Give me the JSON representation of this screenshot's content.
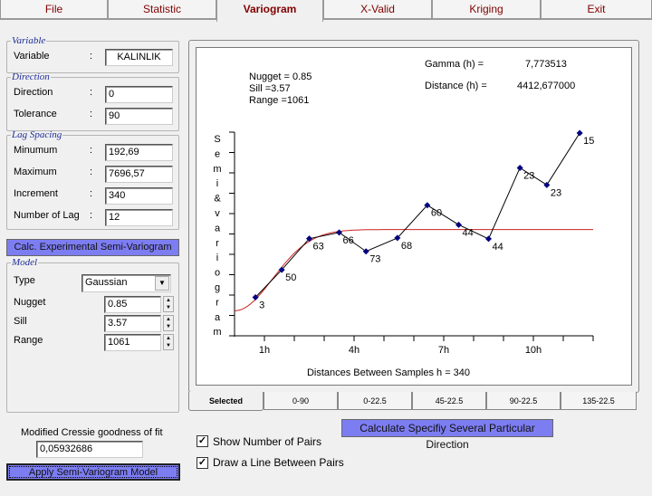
{
  "menu_tabs": [
    {
      "label": "File"
    },
    {
      "label": "Statistic"
    },
    {
      "label": "Variogram",
      "active": true
    },
    {
      "label": "X-Valid"
    },
    {
      "label": "Kriging"
    },
    {
      "label": "Exit"
    }
  ],
  "variable": {
    "legend": "Variable",
    "label": "Variable",
    "sep": ":",
    "value": "KALINLIK"
  },
  "direction": {
    "legend": "Direction",
    "direction_label": "Direction",
    "direction_value": "0",
    "tolerance_label": "Tolerance",
    "tolerance_value": "90"
  },
  "lag": {
    "legend": "Lag Spacing",
    "min_label": "Minumum",
    "min_value": "192,69",
    "max_label": "Maximum",
    "max_value": "7696,57",
    "inc_label": "Increment",
    "inc_value": "340",
    "num_label": "Number of Lag",
    "num_value": "12"
  },
  "calc_button": "Calc. Experimental Semi-Variogram",
  "model": {
    "legend": "Model",
    "type_label": "Type",
    "type_value": "Gaussian",
    "nugget_label": "Nugget",
    "nugget_value": "0.85",
    "sill_label": "Sill",
    "sill_value": "3.57",
    "range_label": "Range",
    "range_value": "1061"
  },
  "fit": {
    "label": "Modified Cressie goodness of fit",
    "value": "0,05932686"
  },
  "apply_button": "Apply Semi-Variogram Model",
  "chart_info": {
    "nugget": "Nugget = 0.85",
    "sill": "Sill =3.57",
    "range": "Range =1061",
    "gamma_label": "Gamma (h)  =",
    "gamma_value": "7,773513",
    "distance_label": "Distance (h) =",
    "distance_value": "4412,677000"
  },
  "chart_data": {
    "type": "scatter",
    "ylabel": "Semi&variogram",
    "xlabel": "Distances Between Samples h = 340",
    "xticks": [
      {
        "at": 1,
        "label": "1h"
      },
      {
        "at": 4,
        "label": "4h"
      },
      {
        "at": 7,
        "label": "7h"
      },
      {
        "at": 10,
        "label": "10h"
      }
    ],
    "xlim": [
      0,
      12
    ],
    "ylim": [
      -0.25,
      8.7
    ],
    "points": [
      {
        "x": 0.7,
        "y": 1.44,
        "pairs": "3"
      },
      {
        "x": 1.58,
        "y": 2.65,
        "pairs": "50"
      },
      {
        "x": 2.5,
        "y": 4.02,
        "pairs": "63"
      },
      {
        "x": 3.5,
        "y": 4.29,
        "pairs": "66"
      },
      {
        "x": 4.4,
        "y": 3.46,
        "pairs": "73"
      },
      {
        "x": 5.45,
        "y": 4.05,
        "pairs": "68"
      },
      {
        "x": 6.45,
        "y": 5.49,
        "pairs": "60"
      },
      {
        "x": 7.5,
        "y": 4.63,
        "pairs": "44"
      },
      {
        "x": 8.5,
        "y": 4.01,
        "pairs": "44"
      },
      {
        "x": 9.55,
        "y": 7.13,
        "pairs": "23"
      },
      {
        "x": 10.45,
        "y": 6.38,
        "pairs": "23"
      },
      {
        "x": 11.55,
        "y": 8.66,
        "pairs": "15"
      }
    ],
    "model": {
      "type": "Gaussian",
      "nugget": 0.85,
      "sill": 3.57,
      "range": 1061,
      "lag": 340
    },
    "point_color": "#000080",
    "model_color": "#cc2222",
    "line_color": "#000000"
  },
  "direction_tabs": [
    {
      "label": "Selected",
      "active": true
    },
    {
      "label": "0-90"
    },
    {
      "label": "0-22.5"
    },
    {
      "label": "45-22.5"
    },
    {
      "label": "90-22.5"
    },
    {
      "label": "135-22.5"
    }
  ],
  "several_button": "Calculate Specifiy Several Particular Direction",
  "options": {
    "show_pairs": "Show Number of Pairs",
    "draw_line": "Draw a Line Between Pairs"
  }
}
